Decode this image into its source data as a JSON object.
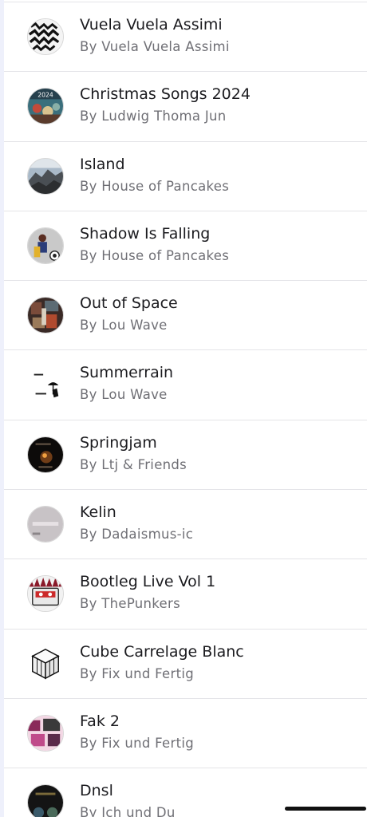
{
  "playlists": [
    {
      "title": "Vuela Vuela Assimi",
      "subtitle": "By Vuela Vuela Assimi",
      "cover_icon": "zigzag-art-cover"
    },
    {
      "title": "Christmas Songs 2024",
      "subtitle": "By Ludwig Thoma Jun",
      "cover_icon": "christmas-2024-cover",
      "cover_text": "2024"
    },
    {
      "title": "Island",
      "subtitle": "By House of Pancakes",
      "cover_icon": "island-landscape-cover"
    },
    {
      "title": "Shadow Is Falling",
      "subtitle": "By House of Pancakes",
      "cover_icon": "figure-portrait-cover"
    },
    {
      "title": "Out of Space",
      "subtitle": "By Lou Wave",
      "cover_icon": "space-collage-cover"
    },
    {
      "title": "Summerrain",
      "subtitle": "By Lou Wave",
      "cover_icon": "umbrella-silhouette-cover"
    },
    {
      "title": "Springjam",
      "subtitle": "By Ltj & Friends",
      "cover_icon": "dark-stage-cover"
    },
    {
      "title": "Kelin",
      "subtitle": "By Dadaismus-ic",
      "cover_icon": "grey-text-cover"
    },
    {
      "title": "Bootleg Live Vol 1",
      "subtitle": "By ThePunkers",
      "cover_icon": "cassette-tape-cover"
    },
    {
      "title": "Cube Carrelage Blanc",
      "subtitle": "By Fix und Fertig",
      "cover_icon": "rubiks-cube-cover"
    },
    {
      "title": "Fak 2",
      "subtitle": "By Fix und Fertig",
      "cover_icon": "pink-collage-cover"
    },
    {
      "title": "Dnsl",
      "subtitle": "By Ich und Du",
      "cover_icon": "dark-cover"
    }
  ]
}
